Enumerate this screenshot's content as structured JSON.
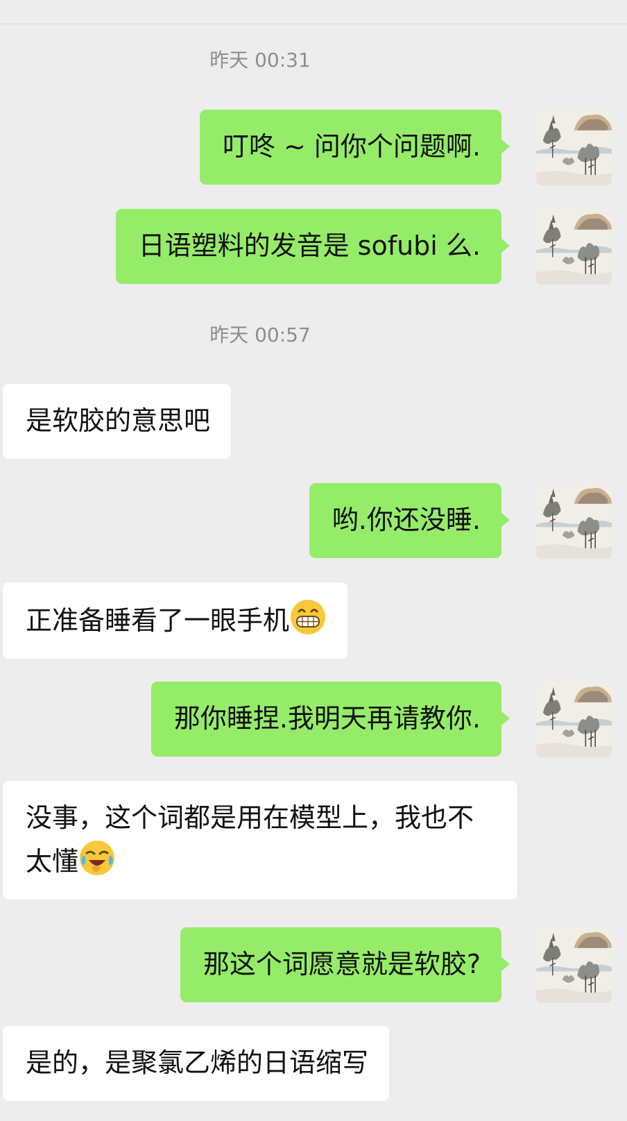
{
  "timestamps": [
    "昨天 00:31",
    "昨天 00:57"
  ],
  "messages": [
    {
      "from": "me",
      "text": "叮咚 ~ 问你个问题啊."
    },
    {
      "from": "me",
      "text": "日语塑料的发音是 sofubi 么."
    },
    {
      "from": "them",
      "text": "是软胶的意思吧"
    },
    {
      "from": "me",
      "text": "哟.你还没睡."
    },
    {
      "from": "them",
      "text": "正准备睡看了一眼手机",
      "emoji": "grinning-face-emoji"
    },
    {
      "from": "me",
      "text": "那你睡捏.我明天再请教你."
    },
    {
      "from": "them",
      "text": "没事，这个词都是用在模型上，我也不太懂",
      "emoji": "laughing-crying-face-emoji"
    },
    {
      "from": "me",
      "text": "那这个词愿意就是软胶?"
    },
    {
      "from": "them",
      "text": "是的，是聚氯乙烯的日语缩写"
    }
  ],
  "avatar": {
    "icon": "landscape-painting-avatar"
  },
  "colors": {
    "background": "#ededed",
    "sent_bubble": "#95ec69",
    "received_bubble": "#ffffff",
    "timestamp_text": "#8d8d8d"
  }
}
